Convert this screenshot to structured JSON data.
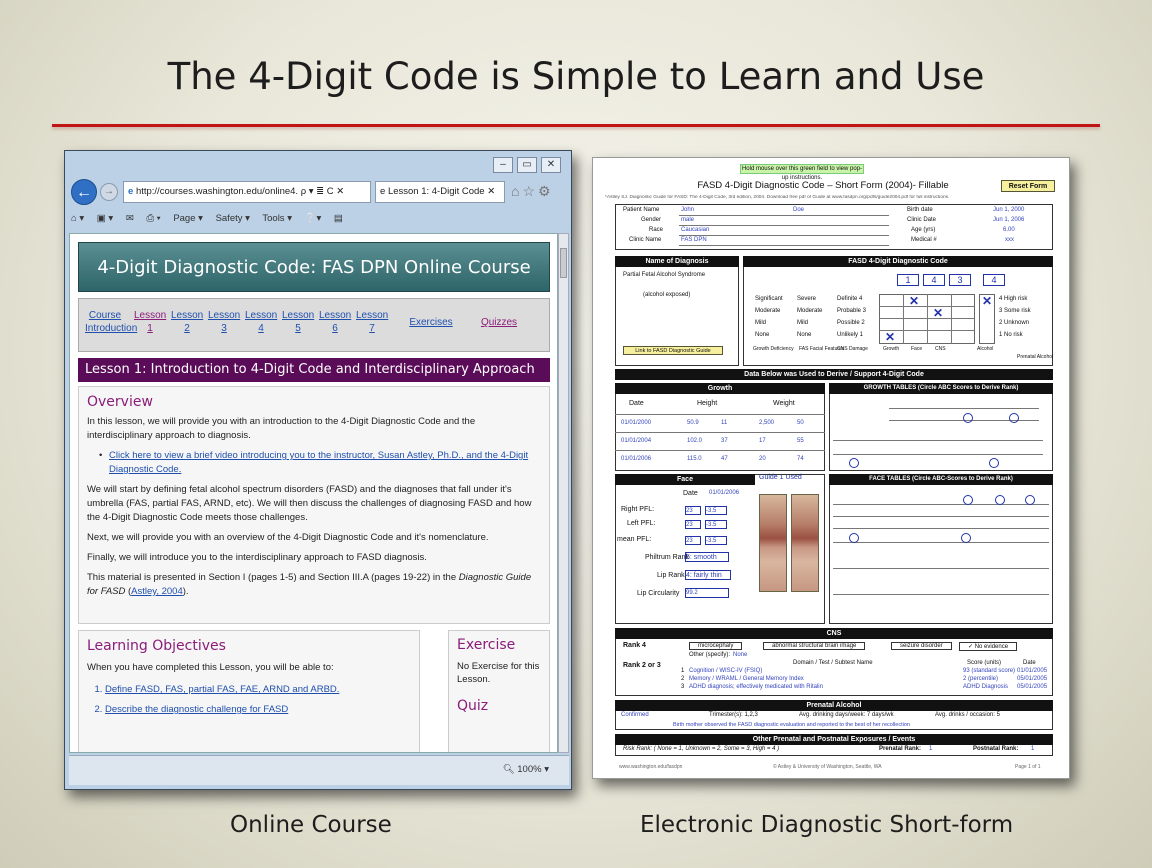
{
  "slide": {
    "title": "The 4-Digit Code is Simple to Learn and Use",
    "caption_left": "Online Course",
    "caption_right": "Electronic  Diagnostic  Short-form"
  },
  "browser": {
    "url": "http://courses.washington.edu/online4.",
    "url_domain": "washington.edu",
    "url_search_suffix": "ρ ▾ ≣ C ✕",
    "tab_title": "Lesson 1: 4-Digit Code",
    "tab_close": "✕",
    "commands": [
      "Page ▾",
      "Safety ▾",
      "Tools ▾"
    ],
    "zoom": "100%",
    "banner": "4-Digit Diagnostic Code: FAS DPN Online Course",
    "nav_items": [
      {
        "label": "Course Introduction",
        "line1": "Course",
        "line2": "Introduction"
      },
      {
        "label": "Lesson 1",
        "line1": "Lesson",
        "line2": "1"
      },
      {
        "label": "Lesson 2",
        "line1": "Lesson",
        "line2": "2"
      },
      {
        "label": "Lesson 3",
        "line1": "Lesson",
        "line2": "3"
      },
      {
        "label": "Lesson 4",
        "line1": "Lesson",
        "line2": "4"
      },
      {
        "label": "Lesson 5",
        "line1": "Lesson",
        "line2": "5"
      },
      {
        "label": "Lesson 6",
        "line1": "Lesson",
        "line2": "6"
      },
      {
        "label": "Lesson 7",
        "line1": "Lesson",
        "line2": "7"
      },
      {
        "label": "Exercises",
        "line1": "Exercises",
        "line2": ""
      },
      {
        "label": "Quizzes",
        "line1": "Quizzes",
        "line2": ""
      }
    ],
    "lesson_header": "Lesson 1: Introduction to 4-Digit Code and Interdisciplinary Approach",
    "overview": {
      "heading": "Overview",
      "intro": "In this lesson, we will provide you with an introduction to the 4-Digit Diagnostic Code and the interdisciplinary approach to diagnosis.",
      "video_link": "Click here to view a brief video introducing you to the instructor, Susan Astley, Ph.D., and the 4-Digit Diagnostic Code.",
      "para2": "We will start by defining fetal alcohol spectrum disorders (FASD) and the diagnoses that fall under it's umbrella (FAS, partial FAS, ARND, etc). We will then discuss the challenges of diagnosing FASD and how the 4-Digit Diagnostic Code meets those challenges.",
      "para3": "Next, we will provide you with an overview of the 4-Digit Diagnostic Code and it's nomenclature.",
      "para4": "Finally, we will introduce you to the interdisciplinary approach to FASD diagnosis.",
      "para5_a": "This material is presented in Section I (pages 1-5) and Section III.A (pages 19-22) in the ",
      "para5_em": "Diagnostic Guide for FASD",
      "para5_link": "Astley, 2004",
      "para5_b": ")."
    },
    "objectives": {
      "heading": "Learning Objectives",
      "intro": "When you have completed this Lesson, you will be able to:",
      "items": [
        "Define FASD, FAS, partial FAS, FAE, ARND and ARBD.",
        "Describe the diagnostic challenge for FASD"
      ]
    },
    "exercise": {
      "heading": "Exercise",
      "text": "No Exercise for this Lesson.",
      "quiz_heading": "Quiz"
    }
  },
  "form": {
    "hint": "Hold mouse over this green field to view pop-up instructions.",
    "title": "FASD 4-Digit Diagnostic Code – Short Form (2004)- Fillable",
    "reset": "Reset Form",
    "subtitle": "*Astley SJ. Diagnostic Guide for FASD: The 4-Digit Code, 3rd edition, 2004. Download free pdf of Guide at www.fasdpn.org/pdfs/guide2004.pdf for full instructions.",
    "patient": [
      {
        "label": "Patient Name",
        "value": "John",
        "value2": "Doe"
      },
      {
        "label": "Gender",
        "value": "male"
      },
      {
        "label": "Race",
        "value": "Caucasian"
      },
      {
        "label": "Clinic Name",
        "value": "FAS DPN"
      }
    ],
    "patient_right": [
      {
        "label": "Birth date",
        "value": "Jun 1, 2000"
      },
      {
        "label": "Clinic Date",
        "value": "Jun 1, 2006"
      },
      {
        "label": "Age (yrs)",
        "value": "6.00"
      },
      {
        "label": "Medical #",
        "value": "xxx"
      }
    ],
    "diagnosis_header": "Name of Diagnosis",
    "diagnosis": "Partial Fetal Alcohol Syndrome",
    "diagnosis2": "(alcohol exposed)",
    "link_guide": "Link to FASD Diagnostic Guide",
    "code_header": "FASD 4-Digit Diagnostic Code",
    "digits": [
      "1",
      "4",
      "3",
      "4"
    ],
    "code_rows_left": [
      "Significant",
      "Moderate",
      "Mild",
      "None"
    ],
    "code_rows_mid": [
      "Severe",
      "Moderate",
      "Mild",
      "None"
    ],
    "code_rows_rank": [
      "Definite  4",
      "Probable  3",
      "Possible  2",
      "Unlikely  1"
    ],
    "code_rows_right": [
      "4  High risk",
      "3  Some risk",
      "2  Unknown",
      "1  No risk"
    ],
    "code_cols": [
      "Growth Deficiency",
      "FAS Facial Features",
      "CNS Damage",
      "Growth",
      "Face",
      "CNS",
      "Alcohol",
      "Prenatal Alcohol"
    ],
    "data_bar": "Data Below was Used to Derive / Support 4-Digit Code",
    "growth_header": "Growth",
    "growth_cols": [
      "Date",
      "Height",
      "Weight"
    ],
    "growth_rows": [
      {
        "date": "01/01/2000",
        "h": "50.9",
        "hp": "11",
        "w": "2,500",
        "wp": "50"
      },
      {
        "date": "01/01/2004",
        "h": "102.0",
        "hp": "37",
        "w": "17",
        "wp": "55"
      },
      {
        "date": "01/01/2006",
        "h": "115.0",
        "hp": "47",
        "w": "20",
        "wp": "74"
      }
    ],
    "growth_tables_header": "GROWTH TABLES (Circle ABC Scores to Derive Rank)",
    "face_header": "Face",
    "guide_used": "Guide 1 Used",
    "face_date_label": "Date",
    "face_date": "01/01/2006",
    "face_rows": [
      {
        "label": "Right PFL:",
        "v": "23",
        "z": "-3.5"
      },
      {
        "label": "Left PFL:",
        "v": "23",
        "z": "-3.5"
      },
      {
        "label": "mean PFL:",
        "v": "23",
        "z": "-3.5"
      }
    ],
    "philtrum_label": "Philtrum Rank",
    "philtrum": "5: smooth",
    "lip_label": "Lip Rank",
    "lip": "4: fairly thin",
    "lipc_label": "Lip Circularity",
    "lipc": "99.2",
    "face_tables_header": "FACE TABLES (Circle ABC-Scores to Derive Rank)",
    "cns_header": "CNS",
    "cns_rank4": "Rank 4",
    "cns_opts": [
      "microcephaly",
      "abnormal structural brain image",
      "seizure disorder",
      "No evidence"
    ],
    "cns_rank23": "Rank 2 or 3",
    "cns_other": "Other (specify):",
    "cns_other_val": "None",
    "cns_domain_hdr": "Domain / Test / Subtest Name",
    "cns_score_hdr": "Score (units)",
    "cns_date_hdr": "Date",
    "cns_rows": [
      {
        "n": "1",
        "name": "Cognition / WISC-IV (FSIQ)",
        "score": "93 (standard score)",
        "date": "01/01/2005"
      },
      {
        "n": "2",
        "name": "Memory / WRAML / General Memory Index",
        "score": "2 (percentile)",
        "date": "05/01/2005"
      },
      {
        "n": "3",
        "name": "ADHD diagnosis; effectively medicated with Ritalin",
        "score": "ADHD Diagnosis",
        "date": "05/01/2005"
      }
    ],
    "prenatal_header": "Prenatal Alcohol",
    "prenatal_conf": "Confirmed",
    "prenatal_trimester": "Trimester(s):  1,2,3",
    "prenatal_days": "Avg. drinking days/week:  7 days/wk",
    "prenatal_drinks": "Avg. drinks / occasion:  5",
    "prenatal_other": "Birth mother observed the FASD diagnostic evaluation and reported to the best of her recollection",
    "other_header": "Other Prenatal and Postnatal Exposures / Events",
    "risk_rank": "Risk Rank: ( None = 1, Unknown = 2, Some = 3, High = 4 )",
    "prenatal_rank_label": "Prenatal Rank:",
    "prenatal_rank": "1",
    "postnatal_rank_label": "Postnatal Rank:",
    "postnatal_rank": "1",
    "footer_left": "www.washington.edu/fasdpn",
    "footer_mid": "© Astley & University of Washington, Seattle, WA",
    "footer_right": "Page 1 of 1"
  }
}
